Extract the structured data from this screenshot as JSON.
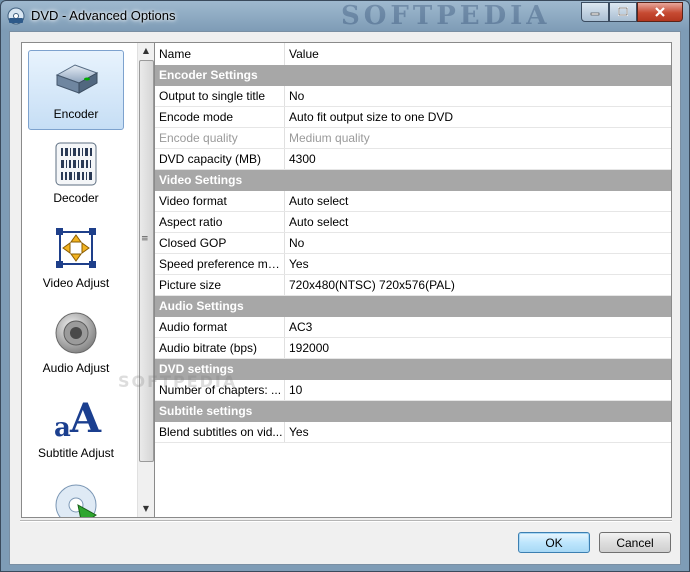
{
  "window": {
    "title": "DVD - Advanced Options",
    "watermark": "SOFTPEDIA",
    "center_watermark": "SOFTPEDIA"
  },
  "nav": {
    "items": [
      {
        "label": "Encoder",
        "icon": "encoder-device-icon",
        "selected": true
      },
      {
        "label": "Decoder",
        "icon": "decoder-barcode-icon",
        "selected": false
      },
      {
        "label": "Video Adjust",
        "icon": "video-adjust-arrows-icon",
        "selected": false
      },
      {
        "label": "Audio Adjust",
        "icon": "speaker-icon",
        "selected": false
      },
      {
        "label": "Subtitle Adjust",
        "icon": "subtitle-letters-icon",
        "selected": false
      },
      {
        "label": "",
        "icon": "disc-icon",
        "selected": false
      }
    ]
  },
  "grid": {
    "col_name": "Name",
    "col_value": "Value",
    "rows": [
      {
        "type": "group",
        "name": "Encoder Settings"
      },
      {
        "type": "prop",
        "name": "Output to single title",
        "value": "No"
      },
      {
        "type": "prop",
        "name": "Encode mode",
        "value": "Auto fit output size to one DVD"
      },
      {
        "type": "prop",
        "name": "Encode quality",
        "value": "Medium quality",
        "disabled": true
      },
      {
        "type": "prop",
        "name": "DVD capacity (MB)",
        "value": "4300"
      },
      {
        "type": "group",
        "name": "Video Settings"
      },
      {
        "type": "prop",
        "name": "Video format",
        "value": "Auto select"
      },
      {
        "type": "prop",
        "name": "Aspect ratio",
        "value": "Auto select"
      },
      {
        "type": "prop",
        "name": "Closed GOP",
        "value": "No"
      },
      {
        "type": "prop",
        "name": "Speed preference mo...",
        "value": "Yes"
      },
      {
        "type": "prop",
        "name": "Picture size",
        "value": "720x480(NTSC) 720x576(PAL)"
      },
      {
        "type": "group",
        "name": "Audio Settings"
      },
      {
        "type": "prop",
        "name": "Audio format",
        "value": "AC3"
      },
      {
        "type": "prop",
        "name": "Audio bitrate (bps)",
        "value": "192000"
      },
      {
        "type": "group",
        "name": "DVD settings"
      },
      {
        "type": "prop",
        "name": "Number of chapters: ...",
        "value": "10"
      },
      {
        "type": "group",
        "name": "Subtitle settings"
      },
      {
        "type": "prop",
        "name": "Blend subtitles on vid...",
        "value": "Yes"
      }
    ]
  },
  "footer": {
    "ok_label": "OK",
    "cancel_label": "Cancel"
  }
}
